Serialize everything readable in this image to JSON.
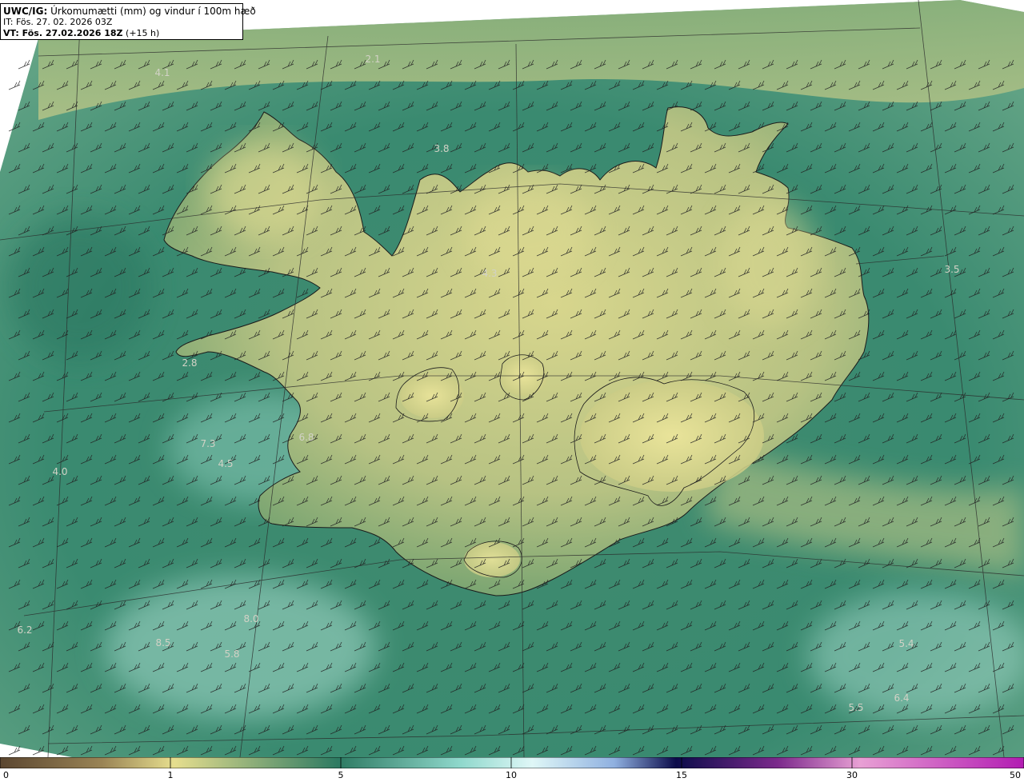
{
  "header": {
    "model_label": "UWC/IG:",
    "title": "Úrkomumætti (mm) og vindur í 100m hæð",
    "init_time": "IT: Fös. 27. 02. 2026 03Z",
    "valid_label": "VT: Fös. 27.02.2026 18Z",
    "valid_offset": "(+15 h)"
  },
  "colorbar": {
    "ticks": [
      "0",
      "1",
      "5",
      "10",
      "15",
      "30",
      "50"
    ],
    "stops": [
      "#5b4630",
      "#9a8455",
      "#e6de8e",
      "#2d7a62",
      "#8fd8cc",
      "#dff7f7",
      "#2b3aa8",
      "#0b0b4a",
      "#7c2a8c",
      "#e8a0d4",
      "#b21bb2"
    ]
  },
  "map": {
    "colors": {
      "sea_dark": "#2f7a63",
      "sea_light": "#8ccab8",
      "land_mid": "#8aa86f",
      "land_high": "#e3df92",
      "coast": "#1b1b1b",
      "grid": "#2a2a2a",
      "barb": "#222222",
      "value_label": "#d2d2c6"
    },
    "value_labels": [
      "4.1",
      "2.1",
      "3.8",
      "4.3",
      "3.5",
      "2.8",
      "6.8",
      "7.3",
      "4.5",
      "4.0",
      "6.2",
      "8.0",
      "8.5",
      "5.8",
      "5.4",
      "5.5",
      "6.4"
    ]
  }
}
